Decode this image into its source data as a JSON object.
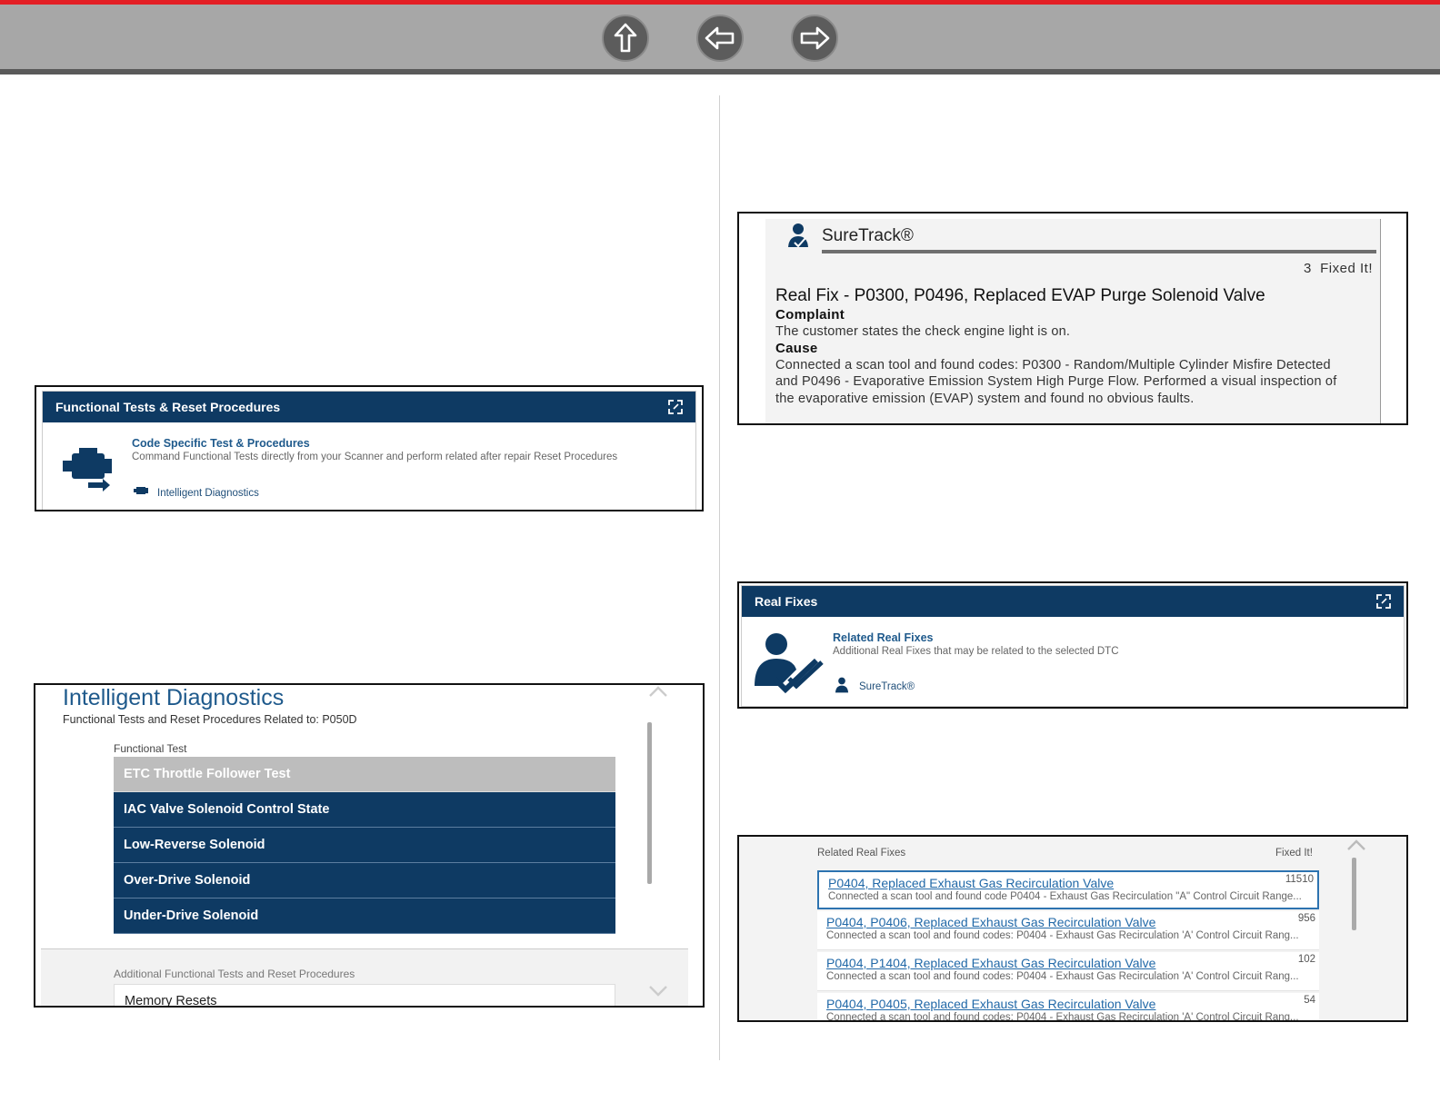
{
  "colors": {
    "accent_red": "#e31e24",
    "nav_bar": "#a7a7a7",
    "panel_blue": "#0e3a63",
    "link_blue": "#2269a8"
  },
  "nav": {
    "up_icon": "arrow-up-icon",
    "back_icon": "arrow-left-icon",
    "forward_icon": "arrow-right-icon"
  },
  "functional_card": {
    "header": "Functional Tests & Reset Procedures",
    "link_title": "Code Specific Test & Procedures",
    "description": "Command Functional Tests directly from your Scanner and perform related after repair Reset Procedures",
    "footer_link": "Intelligent Diagnostics"
  },
  "intelligent_diagnostics": {
    "title": "Intelligent Diagnostics",
    "subtitle": "Functional Tests and Reset Procedures Related to:  P050D",
    "section_label": "Functional Test",
    "tests": [
      "ETC Throttle Follower Test",
      "IAC Valve Solenoid Control State",
      "Low-Reverse Solenoid",
      "Over-Drive Solenoid",
      "Under-Drive Solenoid"
    ],
    "additional_label": "Additional Functional Tests and Reset Procedures",
    "additional_items": [
      "Memory Resets"
    ]
  },
  "suretrack": {
    "title": "SureTrack®",
    "fixed_count": "3",
    "fixed_label": "Fixed It!",
    "fix_title": "Real Fix - P0300, P0496, Replaced EVAP Purge Solenoid Valve",
    "complaint_label": "Complaint",
    "complaint_text": "The customer states the check engine light is on.",
    "cause_label": "Cause",
    "cause_lines": [
      "Connected a scan tool and found codes: P0300 - Random/Multiple Cylinder Misfire Detected",
      "and P0496 - Evaporative Emission System High Purge Flow. Performed a visual inspection of",
      "the evaporative emission (EVAP) system and found no obvious faults."
    ]
  },
  "real_fixes_card": {
    "header": "Real Fixes",
    "link_title": "Related Real Fixes",
    "description": "Additional Real Fixes that may be related to the selected DTC",
    "footer_link": "SureTrack®"
  },
  "related_fixes": {
    "column_left": "Related Real Fixes",
    "column_right": "Fixed It!",
    "rows": [
      {
        "title": "P0404, Replaced Exhaust Gas Recirculation Valve",
        "count": "11510",
        "desc": "Connected a scan tool and found code P0404 - Exhaust Gas Recirculation \"A\" Control Circuit Range..."
      },
      {
        "title": "P0404, P0406, Replaced Exhaust Gas Recirculation Valve",
        "count": "956",
        "desc": "Connected a scan tool and found codes: P0404 - Exhaust Gas Recirculation 'A' Control Circuit Rang..."
      },
      {
        "title": "P0404, P1404, Replaced Exhaust Gas Recirculation Valve",
        "count": "102",
        "desc": "Connected a scan tool and found codes: P0404 - Exhaust Gas Recirculation 'A' Control Circuit Rang..."
      },
      {
        "title": "P0404, P0405, Replaced Exhaust Gas Recirculation Valve",
        "count": "54",
        "desc": "Connected a scan tool and found codes: P0404 - Exhaust Gas Recirculation 'A' Control Circuit Rang..."
      }
    ]
  }
}
